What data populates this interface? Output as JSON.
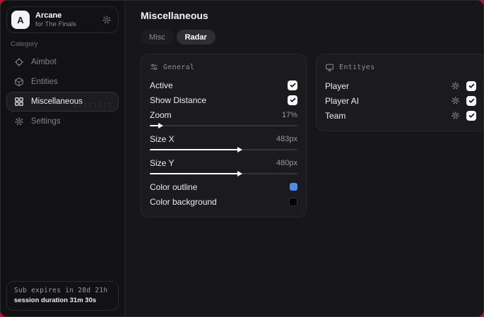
{
  "backdrop_color": "#b31433",
  "profile": {
    "avatar_letter": "A",
    "name": "Arcane",
    "subtitle": "for The Finals",
    "action_icon": "gear-icon"
  },
  "sidebar": {
    "category_label": "Category",
    "items": [
      {
        "label": "Aimbot",
        "icon": "crosshair-icon",
        "active": false
      },
      {
        "label": "Entities",
        "icon": "cube-icon",
        "active": false
      },
      {
        "label": "Miscellaneous",
        "icon": "grid-icon",
        "active": true
      },
      {
        "label": "Settings",
        "icon": "gear-icon",
        "active": false
      }
    ],
    "footer": {
      "sub_expires": "Sub expires in 28d 21h",
      "session_duration": "session duration 31m 30s"
    }
  },
  "main": {
    "title": "Miscellaneous",
    "tabs": [
      {
        "label": "Misc",
        "active": false
      },
      {
        "label": "Radar",
        "active": true
      }
    ],
    "general": {
      "title": "General",
      "icon": "sliders-icon",
      "active": {
        "label": "Active",
        "checked": true
      },
      "show_distance": {
        "label": "Show Distance",
        "checked": true
      },
      "zoom": {
        "label": "Zoom",
        "value": "17%",
        "fill_pct": 6
      },
      "size_x": {
        "label": "Size X",
        "value": "483px",
        "fill_pct": 60
      },
      "size_y": {
        "label": "Size Y",
        "value": "480px",
        "fill_pct": 60
      },
      "color_outline": {
        "label": "Color outline",
        "color": "#4a8ce8"
      },
      "color_background": {
        "label": "Color background",
        "color": "#000000"
      }
    },
    "entities": {
      "title": "Entityes",
      "icon": "monitor-icon",
      "rows": [
        {
          "label": "Player",
          "checked": true
        },
        {
          "label": "Player AI",
          "checked": true
        },
        {
          "label": "Team",
          "checked": true
        }
      ]
    }
  }
}
